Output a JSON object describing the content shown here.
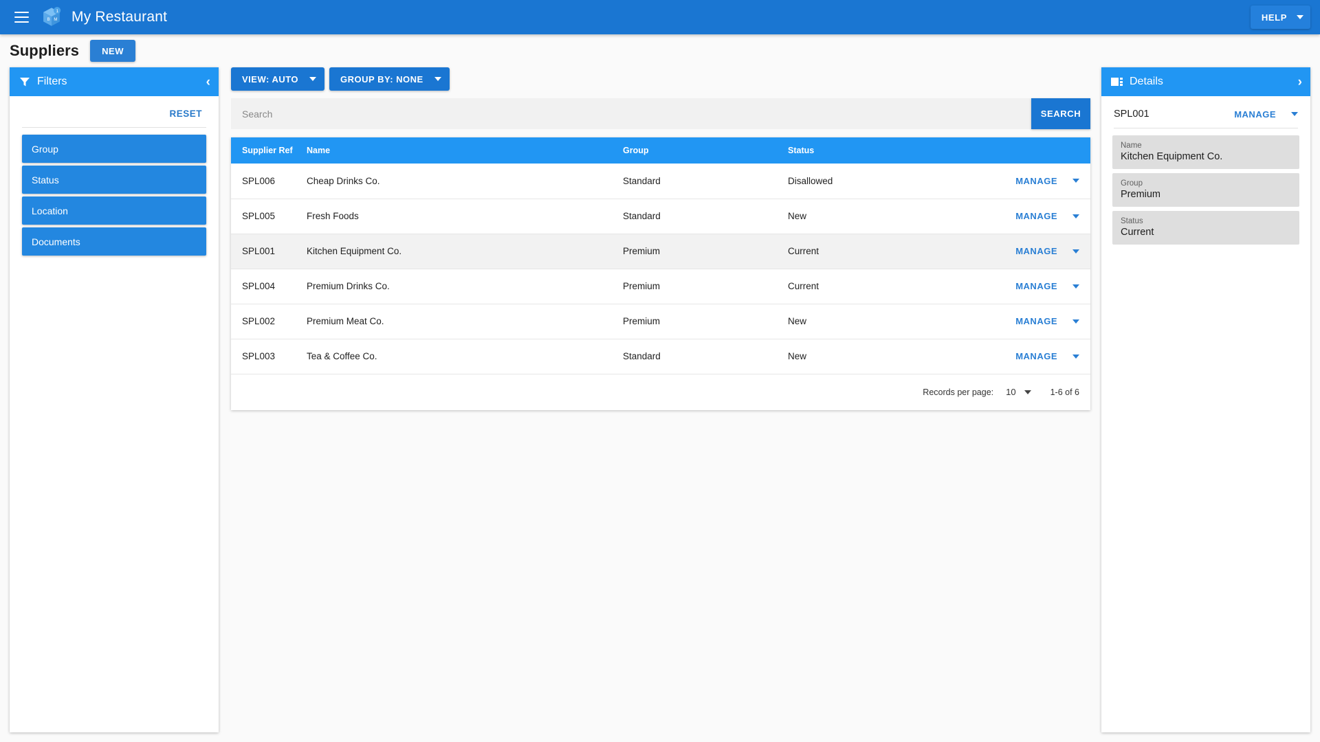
{
  "appbar": {
    "menu_icon": "hamburger-menu-icon",
    "logo_icon": "cube-logo-icon",
    "logo_letters": [
      "B",
      "M"
    ],
    "logo_badge": "1",
    "title": "My Restaurant",
    "help_label": "HELP"
  },
  "page": {
    "title": "Suppliers",
    "new_label": "NEW"
  },
  "filters": {
    "icon": "funnel-filter-icon",
    "title": "Filters",
    "collapse_icon": "chevron-left-icon",
    "reset_label": "RESET",
    "items": [
      {
        "label": "Group"
      },
      {
        "label": "Status"
      },
      {
        "label": "Location"
      },
      {
        "label": "Documents"
      }
    ]
  },
  "toolbar": {
    "view_label": "VIEW: AUTO",
    "group_by_label": "GROUP BY: NONE"
  },
  "search": {
    "placeholder": "Search",
    "value": "",
    "button_label": "SEARCH"
  },
  "table": {
    "columns": [
      "Supplier Ref",
      "Name",
      "Group",
      "Status"
    ],
    "row_action_label": "MANAGE",
    "rows": [
      {
        "ref": "SPL006",
        "name": "Cheap Drinks Co.",
        "group": "Standard",
        "status": "Disallowed",
        "selected": false
      },
      {
        "ref": "SPL005",
        "name": "Fresh Foods",
        "group": "Standard",
        "status": "New",
        "selected": false
      },
      {
        "ref": "SPL001",
        "name": "Kitchen Equipment Co.",
        "group": "Premium",
        "status": "Current",
        "selected": true
      },
      {
        "ref": "SPL004",
        "name": "Premium Drinks Co.",
        "group": "Premium",
        "status": "Current",
        "selected": false
      },
      {
        "ref": "SPL002",
        "name": "Premium Meat Co.",
        "group": "Premium",
        "status": "New",
        "selected": false
      },
      {
        "ref": "SPL003",
        "name": "Tea & Coffee Co.",
        "group": "Standard",
        "status": "New",
        "selected": false
      }
    ]
  },
  "pagination": {
    "records_per_page_label": "Records per page:",
    "records_per_page_value": "10",
    "range_label": "1-6 of 6"
  },
  "details": {
    "icon": "detail-panel-icon",
    "title": "Details",
    "expand_icon": "chevron-right-icon",
    "ref": "SPL001",
    "manage_label": "MANAGE",
    "fields": [
      {
        "label": "Name",
        "value": "Kitchen Equipment Co."
      },
      {
        "label": "Group",
        "value": "Premium"
      },
      {
        "label": "Status",
        "value": "Current"
      }
    ]
  },
  "colors": {
    "appbar": "#1a76d2",
    "panel_header": "#2196f3",
    "accent": "#2a7fd4",
    "filter_button": "#2387e0",
    "field_bg": "#dedede",
    "selected_row": "#f2f2f2",
    "page_bg": "#fafafa"
  }
}
